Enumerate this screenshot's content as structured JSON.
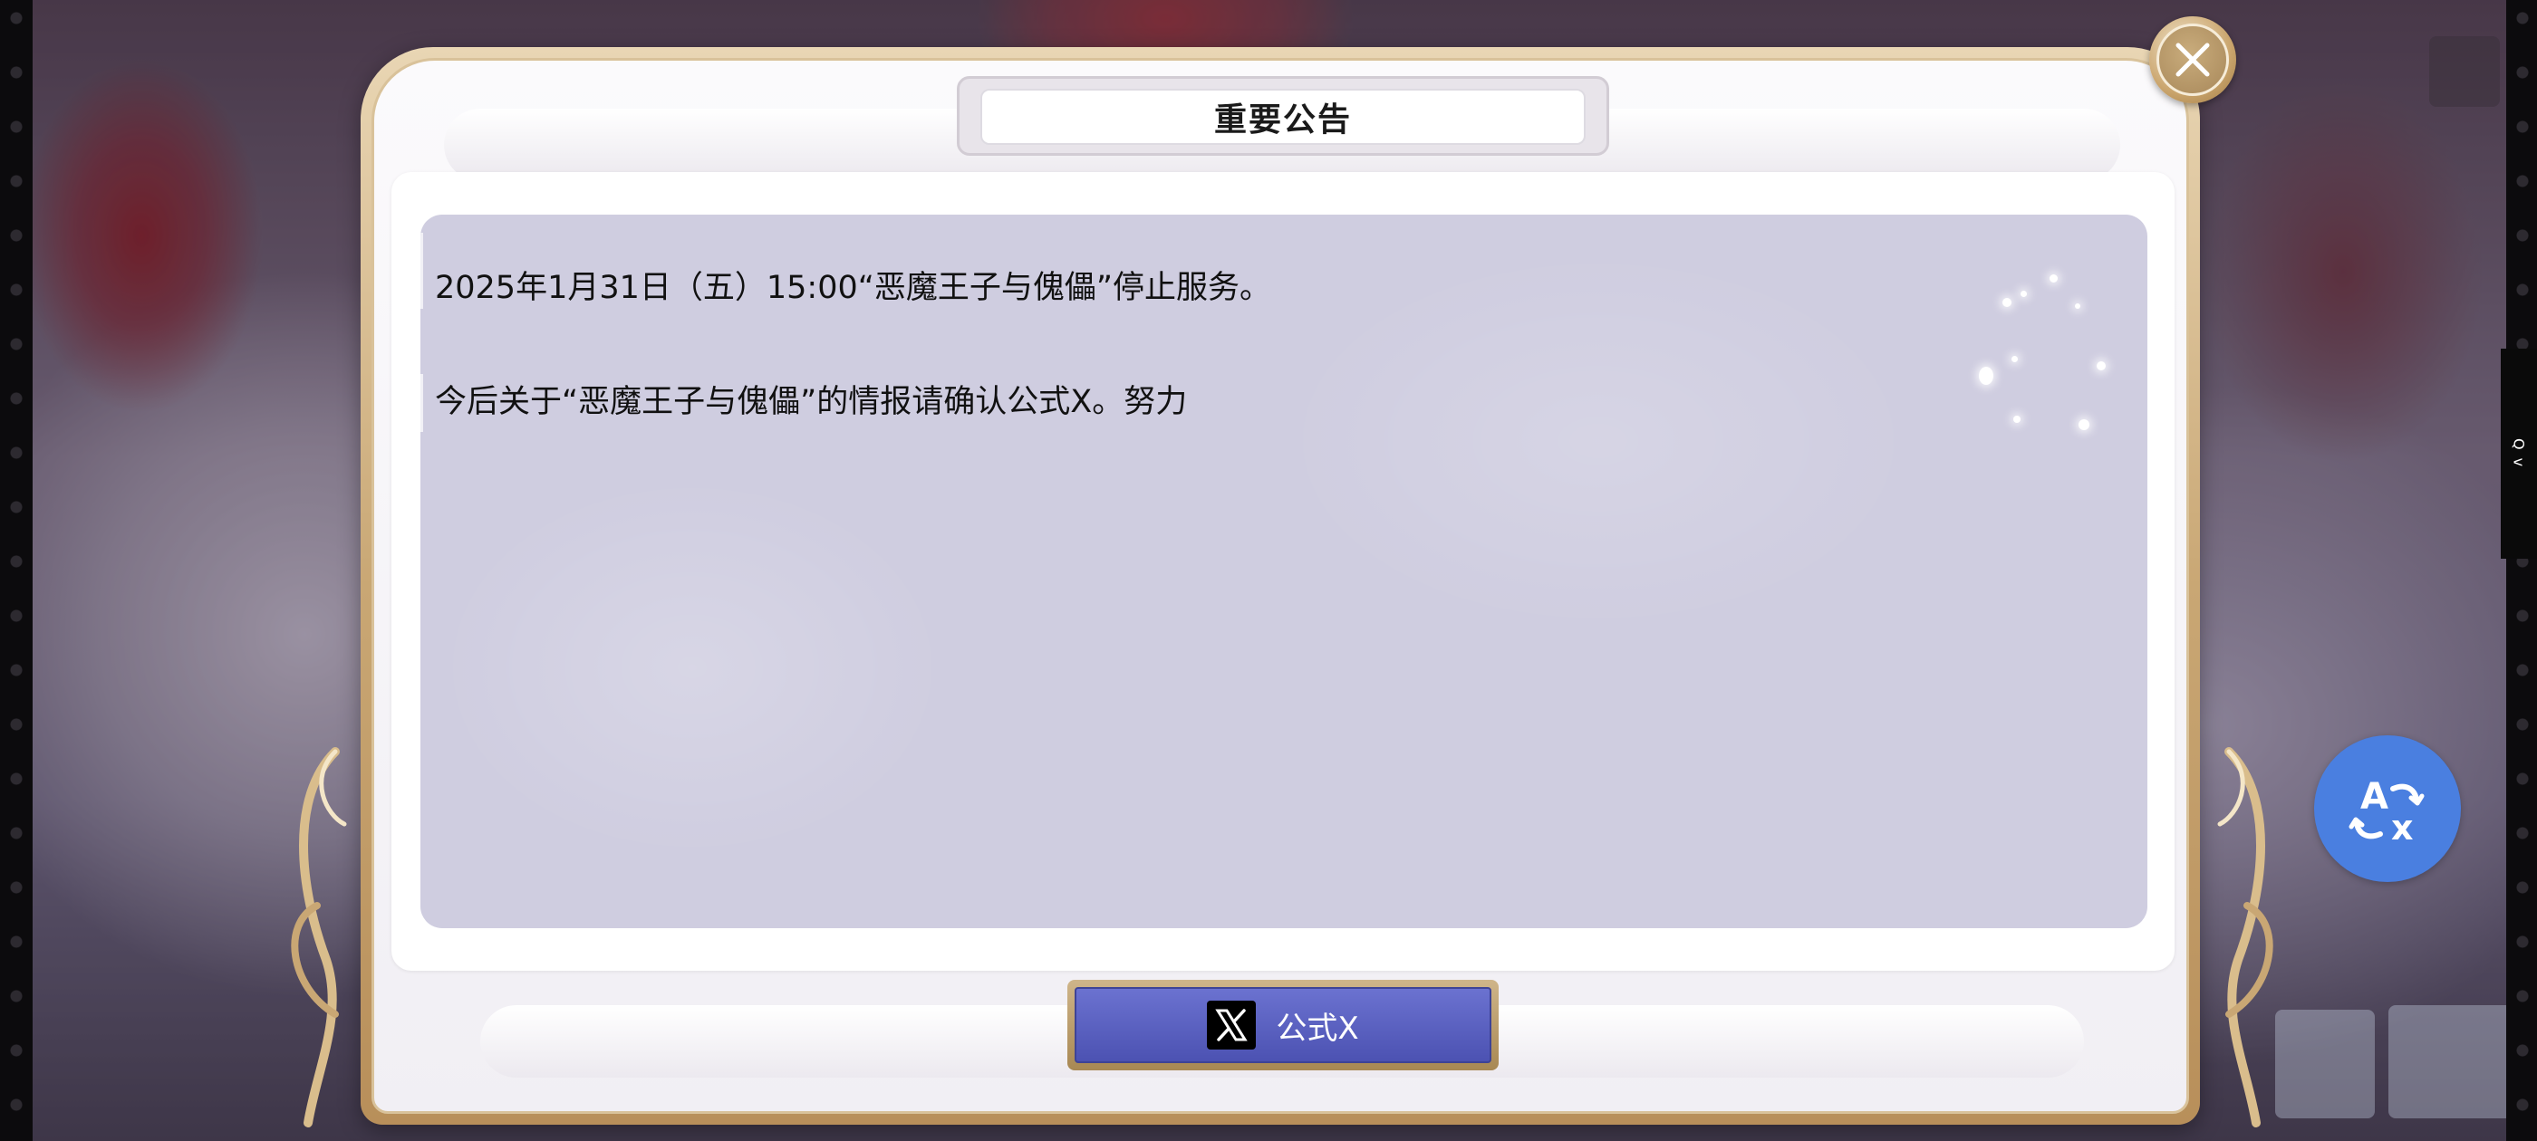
{
  "dialog": {
    "title": "重要公告",
    "lines": [
      "2025年1月31日（五）15:00“恶魔王子与傀儡”停止服务。",
      "今后关于“恶魔王子与傀儡”的情报请确认公式X。努力"
    ],
    "x_button_label": "公式X"
  },
  "side_tab": {
    "text": "Q v"
  },
  "icons": {
    "close": "close-icon",
    "x_logo": "x-logo-icon",
    "translate": "translate-icon"
  },
  "colors": {
    "frame_gold": "#c9a774",
    "content_bg": "#cfcde0",
    "button_blue": "#5158b8",
    "translate_blue": "#4a7fe0"
  }
}
